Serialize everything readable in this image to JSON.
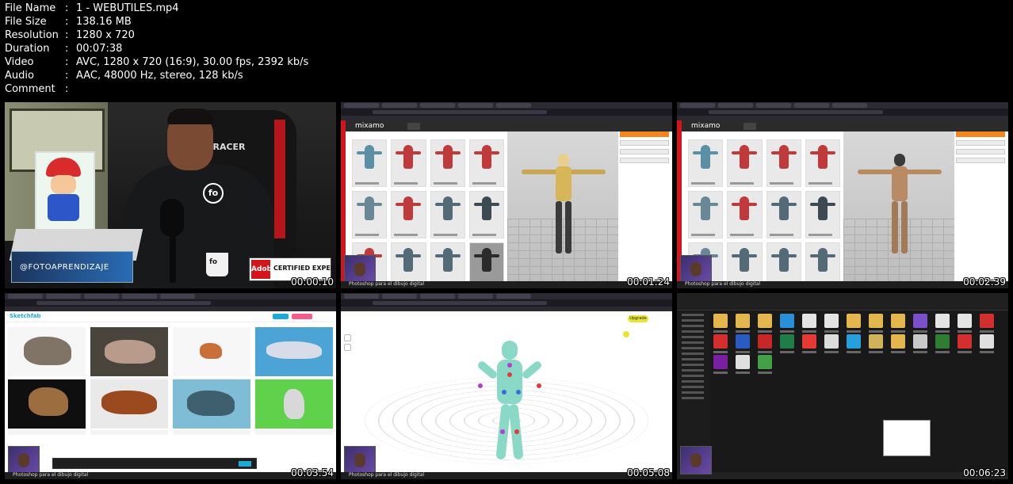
{
  "meta": [
    {
      "key": "File Name",
      "value": "1 - WEBUTILES.mp4"
    },
    {
      "key": "File Size",
      "value": "138.16 MB"
    },
    {
      "key": "Resolution",
      "value": "1280 x 720"
    },
    {
      "key": "Duration",
      "value": "00:07:38"
    },
    {
      "key": "Video",
      "value": "AVC, 1280 x 720 (16:9), 30.00 fps, 2392 kb/s"
    },
    {
      "key": "Audio",
      "value": "AAC, 48000 Hz, stereo, 128 kb/s"
    },
    {
      "key": "Comment",
      "value": ""
    }
  ],
  "separator": ":",
  "thumbs": [
    {
      "timestamp": "00:00:10",
      "banner_left": "@FOTOAPRENDIZAJE",
      "banner_right": "CERTIFIED EXPERT",
      "chair_text": "S-RACER",
      "mug_text": "fo"
    },
    {
      "timestamp": "00:01:24",
      "status": "Photoshop para el dibujo digital",
      "app": "mixamo"
    },
    {
      "timestamp": "00:02:39",
      "status": "Photoshop para el dibujo digital",
      "app": "mixamo"
    },
    {
      "timestamp": "00:03:54",
      "status": "Photoshop para el dibujo digital",
      "app": "Sketchfab"
    },
    {
      "timestamp": "00:05:08",
      "status": "Photoshop para el dibujo digital",
      "upgrade": "Upgrade"
    },
    {
      "timestamp": "00:06:23"
    }
  ],
  "colors": {
    "background": "#000000",
    "adobe_red": "#d4151c",
    "mixamo_orange": "#f5861f",
    "sketchfab_blue": "#1caad9",
    "pose_model": "#8ad8c6"
  }
}
